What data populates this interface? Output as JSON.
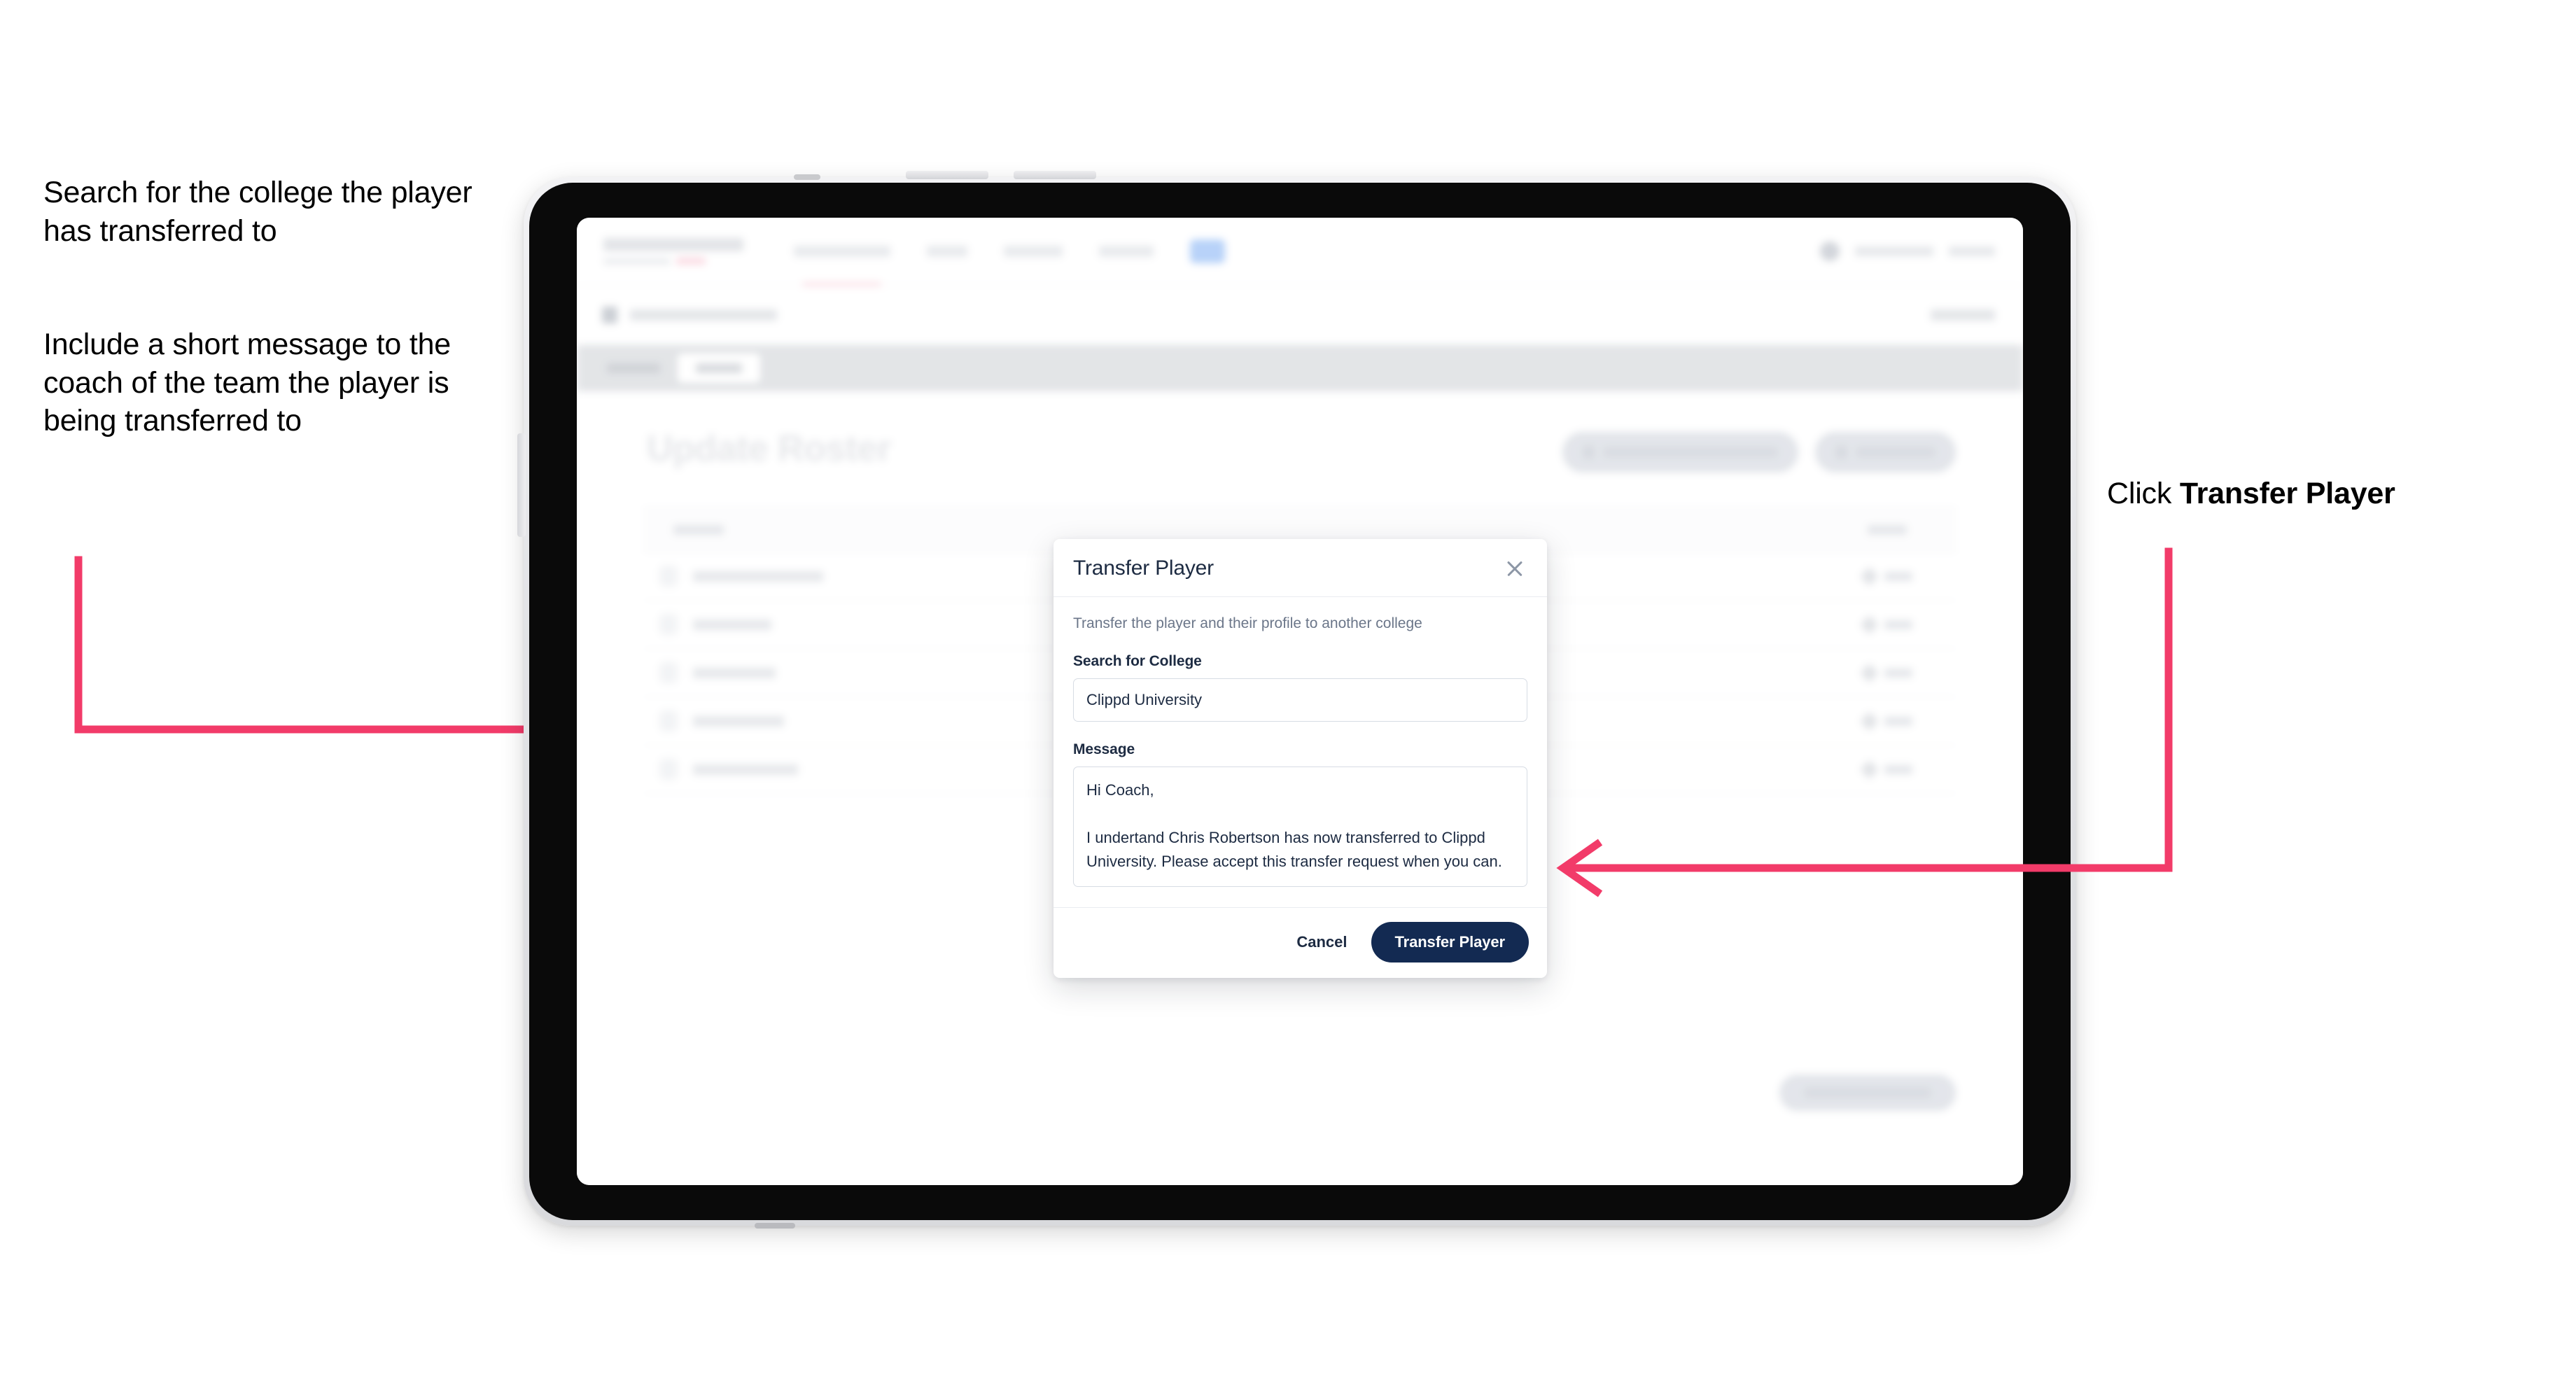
{
  "annotations": {
    "left_1": "Search for the college the player has transferred to",
    "left_2": "Include a short message to the coach of the team the player is being transferred to",
    "right_prefix": "Click ",
    "right_bold": "Transfer Player"
  },
  "colors": {
    "arrow": "#f23b69",
    "primary_button": "#132a52",
    "modal_title": "#1d2b42",
    "muted_text": "#6b7689",
    "border": "#d7dce4"
  },
  "app": {
    "page_title": "Update Roster",
    "nav": {
      "items": [
        "Tournaments",
        "Teams",
        "Leaderboard",
        "Analytics"
      ],
      "active_item": "Roster"
    },
    "tabs": [
      {
        "label": "Overview",
        "active": false
      },
      {
        "label": "Roster",
        "active": true
      }
    ],
    "actions": [
      {
        "label": "Request Player Transfer",
        "icon": "transfer-icon"
      },
      {
        "label": "Add Player",
        "icon": "plus-icon"
      }
    ],
    "roster": {
      "columns": [
        "Player",
        "Edit"
      ],
      "rows": [
        {
          "name": "Chris Robertson",
          "edit_label": "Edit"
        },
        {
          "name": "Ian Whelan",
          "edit_label": "Edit"
        },
        {
          "name": "John Taylor",
          "edit_label": "Edit"
        },
        {
          "name": "Lewis Barton",
          "edit_label": "Edit"
        },
        {
          "name": "Nathan Withers",
          "edit_label": "Edit"
        }
      ]
    },
    "save_button": "Save Roster Changes"
  },
  "modal": {
    "title": "Transfer Player",
    "close_icon": "close-icon",
    "description": "Transfer the player and their profile to another college",
    "college_field": {
      "label": "Search for College",
      "value": "Clippd University",
      "placeholder": "Search for College"
    },
    "message_field": {
      "label": "Message",
      "value": "Hi Coach,\n\nI undertand Chris Robertson has now transferred to Clippd University. Please accept this transfer request when you can.",
      "placeholder": "Message"
    },
    "cancel_label": "Cancel",
    "submit_label": "Transfer Player"
  }
}
